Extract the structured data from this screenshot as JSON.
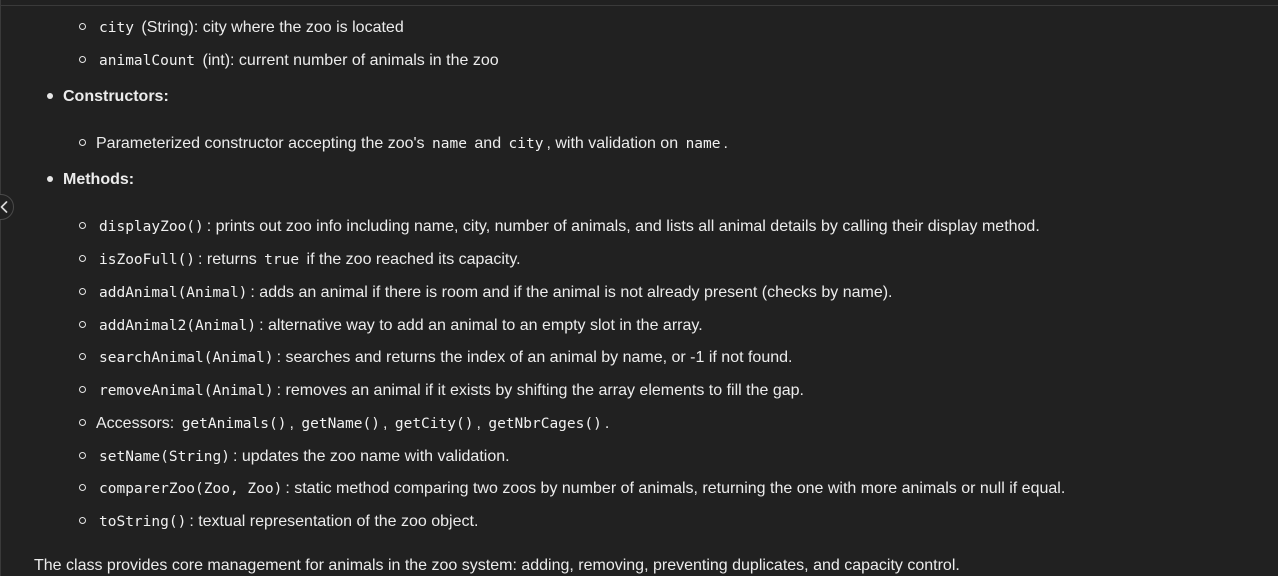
{
  "items": {
    "city": {
      "code": "city",
      "text": "(String): city where the zoo is located"
    },
    "animalCount": {
      "code": "animalCount",
      "text": "(int): current number of animals in the zoo"
    }
  },
  "constructors": {
    "heading": "Constructors:",
    "p1": "Parameterized constructor accepting the zoo's",
    "c1": "name",
    "p2": "and",
    "c2": "city",
    "p3": ", with validation on",
    "c3": "name",
    "p4": "."
  },
  "methods": {
    "heading": "Methods:",
    "displayZoo": {
      "code": "displayZoo()",
      "text": ": prints out zoo info including name, city, number of animals, and lists all animal details by calling their display method."
    },
    "isZooFull": {
      "code": "isZooFull()",
      "text1": ": returns",
      "code2": "true",
      "text2": "if the zoo reached its capacity."
    },
    "addAnimal": {
      "code": "addAnimal(Animal)",
      "text": ": adds an animal if there is room and if the animal is not already present (checks by name)."
    },
    "addAnimal2": {
      "code": "addAnimal2(Animal)",
      "text": ": alternative way to add an animal to an empty slot in the array."
    },
    "searchAnimal": {
      "code": "searchAnimal(Animal)",
      "text": ": searches and returns the index of an animal by name, or -1 if not found."
    },
    "removeAnimal": {
      "code": "removeAnimal(Animal)",
      "text": ": removes an animal if it exists by shifting the array elements to fill the gap."
    },
    "accessors": {
      "label": "Accessors:",
      "a1": "getAnimals()",
      "sep1": ",",
      "a2": "getName()",
      "sep2": ",",
      "a3": "getCity()",
      "sep3": ",",
      "a4": "getNbrCages()",
      "end": "."
    },
    "setName": {
      "code": "setName(String)",
      "text": ": updates the zoo name with validation."
    },
    "comparerZoo": {
      "code": "comparerZoo(Zoo, Zoo)",
      "text": ": static method comparing two zoos by number of animals, returning the one with more animals or null if equal."
    },
    "toString": {
      "code": "toString()",
      "text": ": textual representation of the zoo object."
    }
  },
  "summary": "The class provides core management for animals in the zoo system: adding, removing, preventing duplicates, and capacity control.",
  "icons": {
    "collapse": "chevron-left-icon"
  }
}
